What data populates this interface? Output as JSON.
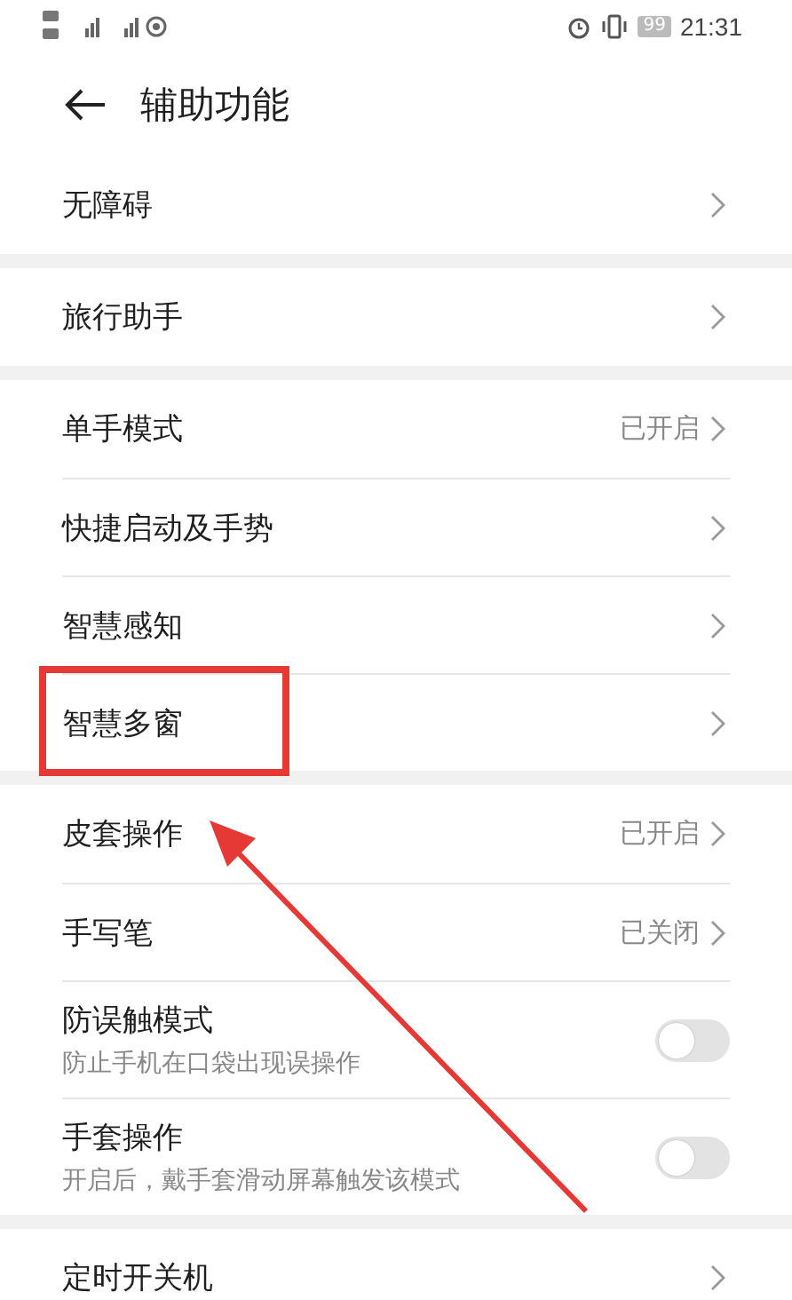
{
  "status_bar": {
    "battery": "99",
    "time": "21:31"
  },
  "header": {
    "title": "辅助功能"
  },
  "groups": [
    [
      {
        "kind": "link",
        "label": "无障碍"
      }
    ],
    [
      {
        "kind": "link",
        "label": "旅行助手"
      }
    ],
    [
      {
        "kind": "link",
        "label": "单手模式",
        "value": "已开启"
      },
      {
        "kind": "link",
        "label": "快捷启动及手势"
      },
      {
        "kind": "link",
        "label": "智慧感知"
      },
      {
        "kind": "link",
        "label": "智慧多窗"
      }
    ],
    [
      {
        "kind": "link",
        "label": "皮套操作",
        "value": "已开启"
      },
      {
        "kind": "link",
        "label": "手写笔",
        "value": "已关闭"
      },
      {
        "kind": "toggle",
        "label": "防误触模式",
        "subtitle": "防止手机在口袋出现误操作",
        "on": false
      },
      {
        "kind": "toggle",
        "label": "手套操作",
        "subtitle": "开启后，戴手套滑动屏幕触发该模式",
        "on": false
      }
    ],
    [
      {
        "kind": "link",
        "label": "定时开关机"
      }
    ]
  ]
}
